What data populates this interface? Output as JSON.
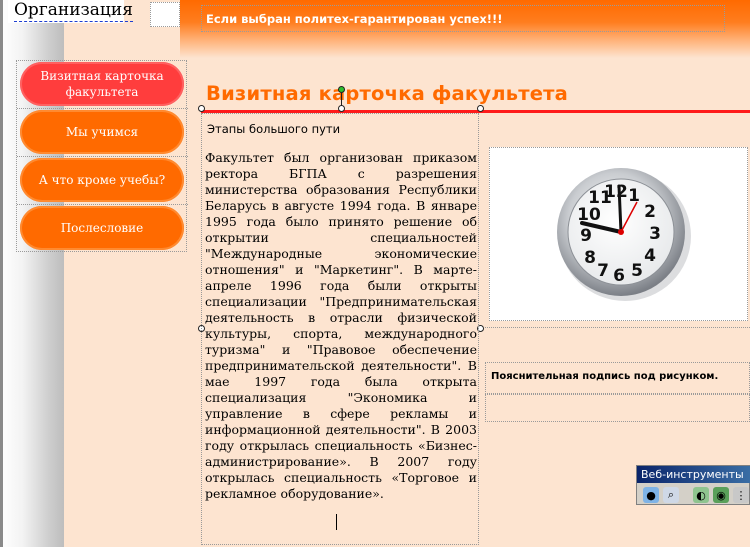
{
  "header": {
    "org_title": "Организация",
    "slogan": "Если выбран политех-гарантирован успех!!!"
  },
  "nav": {
    "items": [
      {
        "label": "Визитная карточка факультета",
        "active": true
      },
      {
        "label": "Мы учимся",
        "active": false
      },
      {
        "label": "А что кроме учебы?",
        "active": false
      },
      {
        "label": "Послесловие",
        "active": false
      }
    ]
  },
  "main": {
    "heading": "Визитная карточка факультета",
    "subheading": "Этапы большого пути",
    "body": "Факультет был организован приказом ректора БГПА с разрешения министерства образования Республики Беларусь в августе 1994 года. В январе 1995 года было принято решение об открытии специальностей \"Международные экономические отношения\" и \"Маркетинг\". В марте-апреле 1996 года были открыты специализации \"Предпринимательская деятельность в отрасли физической культуры, спорта, международного туризма\" и \"Правовое обеспечение предпринимательской деятельности\". В мае 1997 года была открыта специализация \"Экономика и управление в сфере рекламы и информационной деятельности\". В 2003 году открылась специальность «Бизнес-администрирование». В 2007 году открылась специальность «Торговое и рекламное оборудование».",
    "caption": "Пояснительная подпись под рисунком."
  },
  "web_tools": {
    "title": "Веб-инструменты"
  },
  "icons": {
    "clock": "wall-clock-icon"
  },
  "colors": {
    "accent_orange": "#ff6a00",
    "active_nav": "#ff3d3d",
    "rule_red": "#ff1a1a",
    "peach_bg": "#fde4d0"
  }
}
